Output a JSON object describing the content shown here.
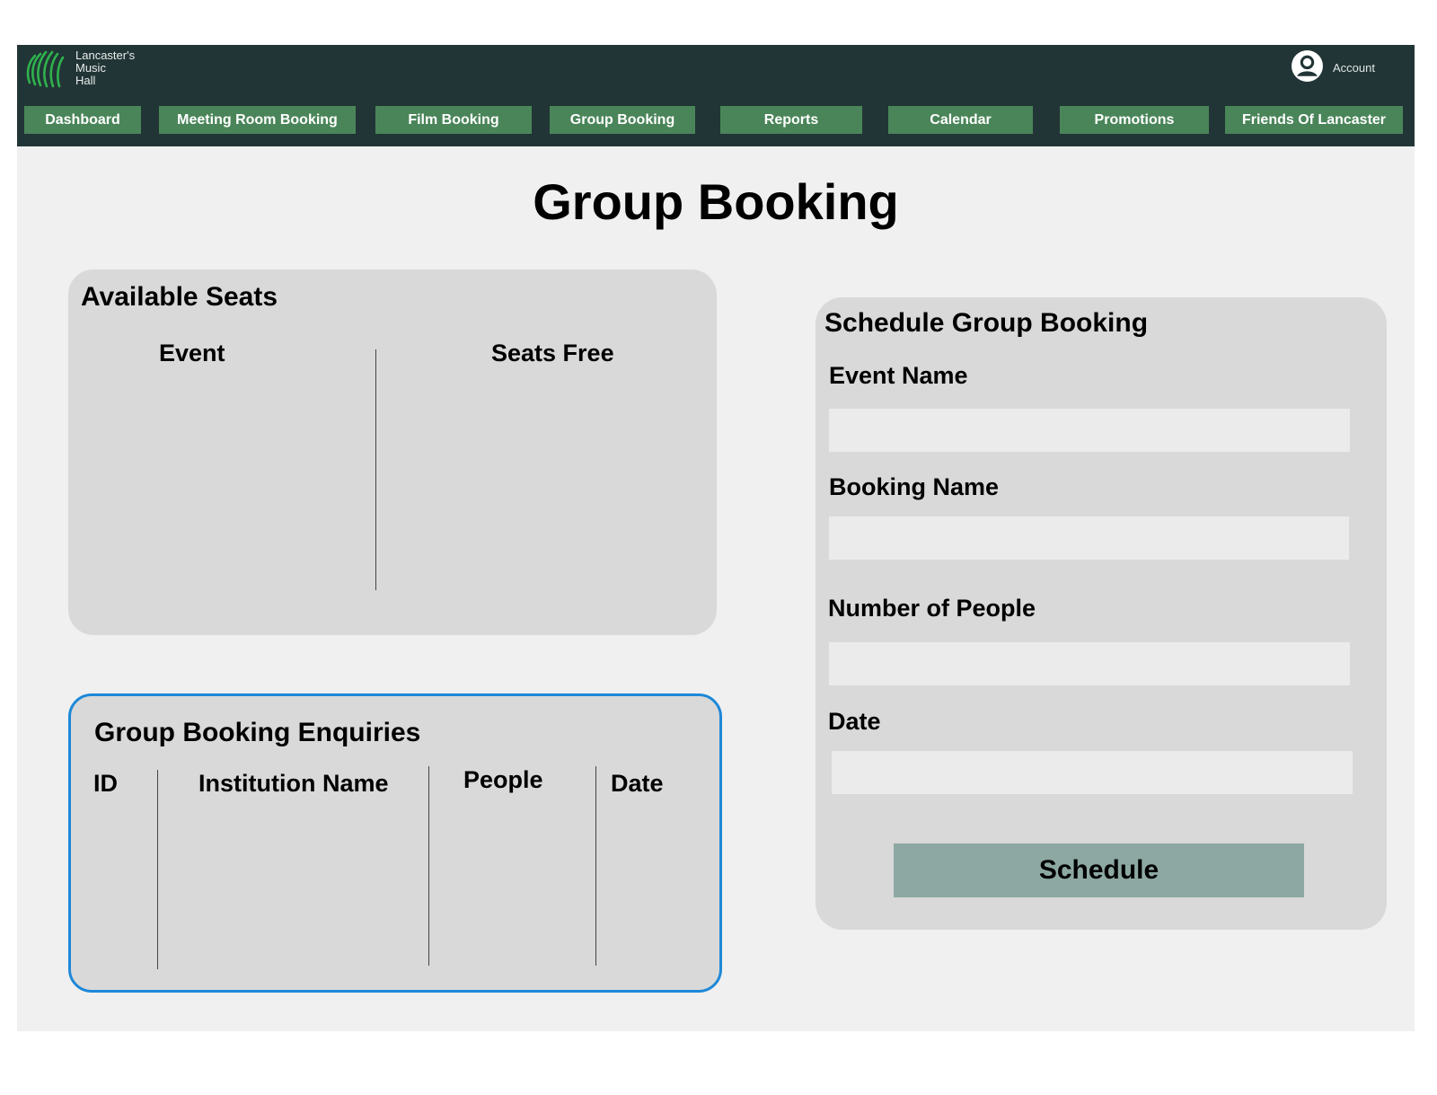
{
  "app": {
    "logo_lines": [
      "Lancaster's",
      "Music",
      "Hall"
    ],
    "account_label": "Account"
  },
  "nav": {
    "items": [
      {
        "label": "Dashboard"
      },
      {
        "label": "Meeting Room Booking"
      },
      {
        "label": "Film Booking"
      },
      {
        "label": "Group Booking"
      },
      {
        "label": "Reports"
      },
      {
        "label": "Calendar"
      },
      {
        "label": "Promotions"
      },
      {
        "label": "Friends Of Lancaster"
      }
    ]
  },
  "page": {
    "title": "Group Booking"
  },
  "available_seats": {
    "title": "Available Seats",
    "columns": [
      "Event",
      "Seats Free"
    ],
    "rows": []
  },
  "enquiries": {
    "title": "Group Booking Enquiries",
    "columns": [
      "ID",
      "Institution Name",
      "People",
      "Date"
    ],
    "rows": []
  },
  "schedule_form": {
    "title": "Schedule Group Booking",
    "fields": [
      {
        "label": "Event Name",
        "value": ""
      },
      {
        "label": "Booking Name",
        "value": ""
      },
      {
        "label": "Number of People",
        "value": ""
      },
      {
        "label": "Date",
        "value": ""
      }
    ],
    "submit_label": "Schedule"
  },
  "colors": {
    "topbar": "#223536",
    "nav_button": "#4a8559",
    "panel": "#d9d9d9",
    "focus_border": "#1e88d8",
    "schedule_button": "#8da8a3"
  }
}
